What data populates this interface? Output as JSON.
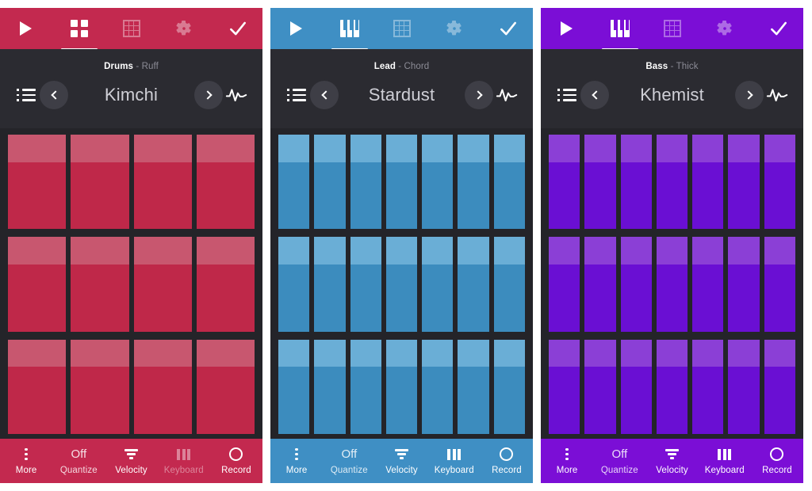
{
  "panels": [
    {
      "id": "drums",
      "accent": "#c3294f",
      "pad_cap": "#c8576f",
      "pad_body": "#bf2849",
      "topbar": {
        "play_label": "Play",
        "tabs": [
          {
            "icon": "pads-icon",
            "label": "Pads",
            "active": true
          },
          {
            "icon": "grid-icon",
            "label": "Grid",
            "active": false
          },
          {
            "icon": "gear-icon",
            "label": "Settings",
            "active": false
          }
        ],
        "confirm_label": "Done"
      },
      "nav": {
        "list_label": "Browse",
        "kit_type": "Drums",
        "kit_sub": "- Ruff",
        "preset_name": "Kimchi",
        "prev_label": "Previous preset",
        "next_label": "Next preset",
        "wave_label": "Waveform"
      },
      "grid": {
        "rows": 3,
        "cols": 4
      },
      "bottombar": [
        {
          "name": "more",
          "label": "More",
          "glyph": "dots3",
          "state": "normal"
        },
        {
          "name": "quantize",
          "label": "Quantize",
          "glyph": "value",
          "value": "Off",
          "state": "soft"
        },
        {
          "name": "velocity",
          "label": "Velocity",
          "glyph": "velocity",
          "state": "normal"
        },
        {
          "name": "keyboard",
          "label": "Keyboard",
          "glyph": "keyboard",
          "state": "faded"
        },
        {
          "name": "record",
          "label": "Record",
          "glyph": "record",
          "state": "normal"
        }
      ]
    },
    {
      "id": "lead",
      "accent": "#3f8fc4",
      "pad_cap": "#6aaed6",
      "pad_body": "#3c8cbe",
      "topbar": {
        "play_label": "Play",
        "tabs": [
          {
            "icon": "piano-icon",
            "label": "Keys",
            "active": true
          },
          {
            "icon": "grid-icon",
            "label": "Grid",
            "active": false
          },
          {
            "icon": "gear-icon",
            "label": "Settings",
            "active": false
          }
        ],
        "confirm_label": "Done"
      },
      "nav": {
        "list_label": "Browse",
        "kit_type": "Lead",
        "kit_sub": "- Chord",
        "preset_name": "Stardust",
        "prev_label": "Previous preset",
        "next_label": "Next preset",
        "wave_label": "Waveform"
      },
      "grid": {
        "rows": 3,
        "cols": 7
      },
      "bottombar": [
        {
          "name": "more",
          "label": "More",
          "glyph": "dots3",
          "state": "normal"
        },
        {
          "name": "quantize",
          "label": "Quantize",
          "glyph": "value",
          "value": "Off",
          "state": "soft"
        },
        {
          "name": "velocity",
          "label": "Velocity",
          "glyph": "velocity",
          "state": "normal"
        },
        {
          "name": "keyboard",
          "label": "Keyboard",
          "glyph": "keyboard",
          "state": "normal"
        },
        {
          "name": "record",
          "label": "Record",
          "glyph": "record",
          "state": "normal"
        }
      ]
    },
    {
      "id": "bass",
      "accent": "#7b0ed6",
      "pad_cap": "#8b3fd6",
      "pad_body": "#6a0fd3",
      "topbar": {
        "play_label": "Play",
        "tabs": [
          {
            "icon": "piano-icon",
            "label": "Keys",
            "active": true
          },
          {
            "icon": "grid-icon",
            "label": "Grid",
            "active": false
          },
          {
            "icon": "gear-icon",
            "label": "Settings",
            "active": false
          }
        ],
        "confirm_label": "Done"
      },
      "nav": {
        "list_label": "Browse",
        "kit_type": "Bass",
        "kit_sub": "- Thick",
        "preset_name": "Khemist",
        "prev_label": "Previous preset",
        "next_label": "Next preset",
        "wave_label": "Waveform"
      },
      "grid": {
        "rows": 3,
        "cols": 7
      },
      "bottombar": [
        {
          "name": "more",
          "label": "More",
          "glyph": "dots3",
          "state": "normal"
        },
        {
          "name": "quantize",
          "label": "Quantize",
          "glyph": "value",
          "value": "Off",
          "state": "soft"
        },
        {
          "name": "velocity",
          "label": "Velocity",
          "glyph": "velocity",
          "state": "normal"
        },
        {
          "name": "keyboard",
          "label": "Keyboard",
          "glyph": "keyboard",
          "state": "normal"
        },
        {
          "name": "record",
          "label": "Record",
          "glyph": "record",
          "state": "normal"
        }
      ]
    }
  ]
}
